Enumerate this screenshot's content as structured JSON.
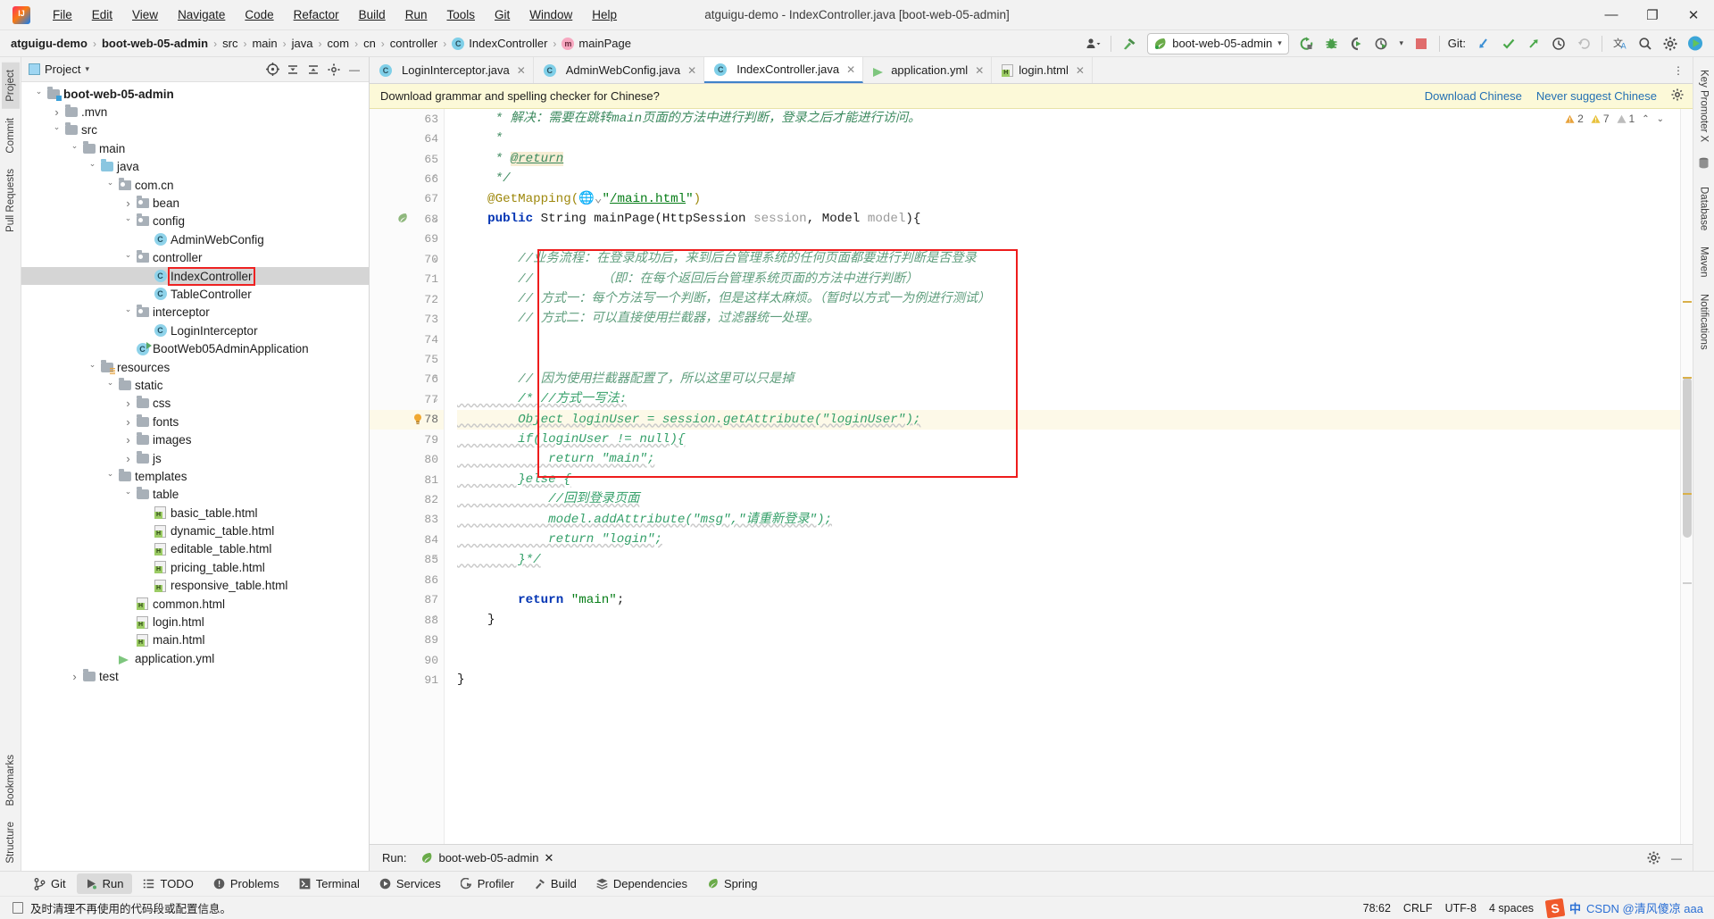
{
  "window": {
    "title": "atguigu-demo - IndexController.java [boot-web-05-admin]",
    "minimize": "—",
    "maximize": "❐",
    "close": "✕"
  },
  "menu": [
    {
      "label": "File"
    },
    {
      "label": "Edit"
    },
    {
      "label": "View"
    },
    {
      "label": "Navigate"
    },
    {
      "label": "Code"
    },
    {
      "label": "Refactor"
    },
    {
      "label": "Build"
    },
    {
      "label": "Run"
    },
    {
      "label": "Tools"
    },
    {
      "label": "Git"
    },
    {
      "label": "Window"
    },
    {
      "label": "Help"
    }
  ],
  "breadcrumb": [
    {
      "label": "atguigu-demo",
      "bold": true,
      "icon": ""
    },
    {
      "label": "boot-web-05-admin",
      "bold": true,
      "icon": ""
    },
    {
      "label": "src",
      "bold": false,
      "icon": ""
    },
    {
      "label": "main",
      "bold": false,
      "icon": ""
    },
    {
      "label": "java",
      "bold": false,
      "icon": ""
    },
    {
      "label": "com",
      "bold": false,
      "icon": ""
    },
    {
      "label": "cn",
      "bold": false,
      "icon": ""
    },
    {
      "label": "controller",
      "bold": false,
      "icon": ""
    },
    {
      "label": "IndexController",
      "bold": false,
      "icon": "class-icon"
    },
    {
      "label": "mainPage",
      "bold": false,
      "icon": "method-icon"
    }
  ],
  "toolbar": {
    "run_config": "boot-web-05-admin",
    "git_label": "Git:",
    "search_everywhere": "search-icon",
    "settings": "gear-icon"
  },
  "project_panel": {
    "title": "Project",
    "tree": [
      {
        "depth": 0,
        "arrow": "open",
        "icon": "folder-module",
        "label": "boot-web-05-admin",
        "bold": true
      },
      {
        "depth": 1,
        "arrow": "closed",
        "icon": "folder",
        "label": ".mvn",
        "bold": false
      },
      {
        "depth": 1,
        "arrow": "open",
        "icon": "folder",
        "label": "src",
        "bold": false
      },
      {
        "depth": 2,
        "arrow": "open",
        "icon": "folder",
        "label": "main",
        "bold": false
      },
      {
        "depth": 3,
        "arrow": "open",
        "icon": "folder-source",
        "label": "java",
        "bold": false
      },
      {
        "depth": 4,
        "arrow": "open",
        "icon": "package",
        "label": "com.cn",
        "bold": false
      },
      {
        "depth": 5,
        "arrow": "closed",
        "icon": "package",
        "label": "bean",
        "bold": false
      },
      {
        "depth": 5,
        "arrow": "open",
        "icon": "package",
        "label": "config",
        "bold": false
      },
      {
        "depth": 6,
        "arrow": "none",
        "icon": "class",
        "label": "AdminWebConfig",
        "bold": false
      },
      {
        "depth": 5,
        "arrow": "open",
        "icon": "package",
        "label": "controller",
        "bold": false
      },
      {
        "depth": 6,
        "arrow": "none",
        "icon": "class",
        "label": "IndexController",
        "bold": false,
        "selected": true,
        "highlight": true
      },
      {
        "depth": 6,
        "arrow": "none",
        "icon": "class",
        "label": "TableController",
        "bold": false
      },
      {
        "depth": 5,
        "arrow": "open",
        "icon": "package",
        "label": "interceptor",
        "bold": false
      },
      {
        "depth": 6,
        "arrow": "none",
        "icon": "class",
        "label": "LoginInterceptor",
        "bold": false
      },
      {
        "depth": 5,
        "arrow": "none",
        "icon": "class-run",
        "label": "BootWeb05AdminApplication",
        "bold": false
      },
      {
        "depth": 3,
        "arrow": "open",
        "icon": "folder-res",
        "label": "resources",
        "bold": false
      },
      {
        "depth": 4,
        "arrow": "open",
        "icon": "folder",
        "label": "static",
        "bold": false
      },
      {
        "depth": 5,
        "arrow": "closed",
        "icon": "folder",
        "label": "css",
        "bold": false
      },
      {
        "depth": 5,
        "arrow": "closed",
        "icon": "folder",
        "label": "fonts",
        "bold": false
      },
      {
        "depth": 5,
        "arrow": "closed",
        "icon": "folder",
        "label": "images",
        "bold": false
      },
      {
        "depth": 5,
        "arrow": "closed",
        "icon": "folder",
        "label": "js",
        "bold": false
      },
      {
        "depth": 4,
        "arrow": "open",
        "icon": "folder",
        "label": "templates",
        "bold": false
      },
      {
        "depth": 5,
        "arrow": "open",
        "icon": "folder",
        "label": "table",
        "bold": false
      },
      {
        "depth": 6,
        "arrow": "none",
        "icon": "html",
        "label": "basic_table.html",
        "bold": false
      },
      {
        "depth": 6,
        "arrow": "none",
        "icon": "html",
        "label": "dynamic_table.html",
        "bold": false
      },
      {
        "depth": 6,
        "arrow": "none",
        "icon": "html",
        "label": "editable_table.html",
        "bold": false
      },
      {
        "depth": 6,
        "arrow": "none",
        "icon": "html",
        "label": "pricing_table.html",
        "bold": false
      },
      {
        "depth": 6,
        "arrow": "none",
        "icon": "html",
        "label": "responsive_table.html",
        "bold": false
      },
      {
        "depth": 5,
        "arrow": "none",
        "icon": "html",
        "label": "common.html",
        "bold": false
      },
      {
        "depth": 5,
        "arrow": "none",
        "icon": "html",
        "label": "login.html",
        "bold": false
      },
      {
        "depth": 5,
        "arrow": "none",
        "icon": "html",
        "label": "main.html",
        "bold": false
      },
      {
        "depth": 4,
        "arrow": "none",
        "icon": "yml",
        "label": "application.yml",
        "bold": false
      },
      {
        "depth": 2,
        "arrow": "closed",
        "icon": "folder",
        "label": "test",
        "bold": false
      }
    ]
  },
  "left_strip": [
    "Project",
    "Commit",
    "Pull Requests",
    "Bookmarks",
    "Structure"
  ],
  "right_strip": [
    "Key Promoter X",
    "Database",
    "Maven",
    "Notifications"
  ],
  "editor": {
    "tabs": [
      {
        "label": "LoginInterceptor.java",
        "icon": "class-icon",
        "active": false
      },
      {
        "label": "AdminWebConfig.java",
        "icon": "class-icon",
        "active": false
      },
      {
        "label": "IndexController.java",
        "icon": "class-icon",
        "active": true
      },
      {
        "label": "application.yml",
        "icon": "yml-icon",
        "active": false
      },
      {
        "label": "login.html",
        "icon": "html-icon",
        "active": false
      }
    ],
    "notification": {
      "message": "Download grammar and spelling checker for Chinese?",
      "action_primary": "Download Chinese",
      "action_secondary": "Never suggest Chinese"
    },
    "inspection": {
      "error_count": "2",
      "warning_count": "7",
      "weak_count": "1"
    },
    "first_line": 63,
    "current_line": 78,
    "lines": [
      {
        "n": 63,
        "text": "     * 解决：需要在跳转main页面的方法中进行判断，登录之后才能进行访问。",
        "style": "javadoc-zh"
      },
      {
        "n": 64,
        "text": "     *",
        "style": "javadoc"
      },
      {
        "n": 65,
        "text": "     * @return",
        "style": "javadoc-tag"
      },
      {
        "n": 66,
        "text": "     */",
        "style": "javadoc",
        "fold": "end"
      },
      {
        "n": 67,
        "text": "    @GetMapping(\"/main.html\")",
        "style": "annotation"
      },
      {
        "n": 68,
        "text": "    public String mainPage(HttpSession session, Model model){",
        "style": "code",
        "gutter": "bean",
        "fold": "start"
      },
      {
        "n": 69,
        "text": "",
        "style": "code"
      },
      {
        "n": 70,
        "text": "        //业务流程：在登录成功后，来到后台管理系统的任何页面都要进行判断是否登录",
        "style": "comment-zh",
        "fold": "start"
      },
      {
        "n": 71,
        "text": "        //         （即：在每个返回后台管理系统页面的方法中进行判断）",
        "style": "comment-zh"
      },
      {
        "n": 72,
        "text": "        // 方式一：每个方法写一个判断，但是这样太麻烦。（暂时以方式一为例进行测试）",
        "style": "comment-zh"
      },
      {
        "n": 73,
        "text": "        // 方式二：可以直接使用拦截器，过滤器统一处理。",
        "style": "comment-zh"
      },
      {
        "n": 74,
        "text": "",
        "style": "code"
      },
      {
        "n": 75,
        "text": "",
        "style": "code"
      },
      {
        "n": 76,
        "text": "        // 因为使用拦截器配置了，所以这里可以只是掉",
        "style": "comment-zh",
        "fold": "end"
      },
      {
        "n": 77,
        "text": "        /* //方式一写法:",
        "style": "comment-block",
        "fold": "start"
      },
      {
        "n": 78,
        "text": "        Object loginUser = session.getAttribute(\"loginUser\");",
        "style": "comment-block",
        "current": true,
        "bulb": true
      },
      {
        "n": 79,
        "text": "        if(loginUser != null){",
        "style": "comment-block"
      },
      {
        "n": 80,
        "text": "            return \"main\";",
        "style": "comment-block"
      },
      {
        "n": 81,
        "text": "        }else {",
        "style": "comment-block"
      },
      {
        "n": 82,
        "text": "            //回到登录页面",
        "style": "comment-block"
      },
      {
        "n": 83,
        "text": "            model.addAttribute(\"msg\",\"请重新登录\");",
        "style": "comment-block"
      },
      {
        "n": 84,
        "text": "            return \"login\";",
        "style": "comment-block"
      },
      {
        "n": 85,
        "text": "        }*/",
        "style": "comment-block",
        "fold": "end"
      },
      {
        "n": 86,
        "text": "",
        "style": "code"
      },
      {
        "n": 87,
        "text": "        return \"main\";",
        "style": "code"
      },
      {
        "n": 88,
        "text": "    }",
        "style": "code",
        "fold": "end"
      },
      {
        "n": 89,
        "text": "",
        "style": "code"
      },
      {
        "n": 90,
        "text": "",
        "style": "code"
      },
      {
        "n": 91,
        "text": "}",
        "style": "code"
      }
    ]
  },
  "run_panel": {
    "label": "Run:",
    "tab_label": "boot-web-05-admin",
    "close": "✕"
  },
  "bottom_tabs": [
    {
      "label": "Git",
      "icon": "git-branch-icon",
      "active": false
    },
    {
      "label": "Run",
      "icon": "run-icon",
      "active": true
    },
    {
      "label": "TODO",
      "icon": "todo-icon",
      "active": false
    },
    {
      "label": "Problems",
      "icon": "problems-icon",
      "active": false
    },
    {
      "label": "Terminal",
      "icon": "terminal-icon",
      "active": false
    },
    {
      "label": "Services",
      "icon": "services-icon",
      "active": false
    },
    {
      "label": "Profiler",
      "icon": "profiler-icon",
      "active": false
    },
    {
      "label": "Build",
      "icon": "build-icon",
      "active": false
    },
    {
      "label": "Dependencies",
      "icon": "dependencies-icon",
      "active": false
    },
    {
      "label": "Spring",
      "icon": "spring-icon",
      "active": false
    }
  ],
  "statusbar": {
    "hint": "及时清理不再使用的代码段或配置信息。",
    "caret": "78:62",
    "line_sep": "CRLF",
    "encoding": "UTF-8",
    "indent": "4 spaces",
    "watermark_cn": "CSDN @清风傻凉 aaa",
    "ime": "中"
  }
}
